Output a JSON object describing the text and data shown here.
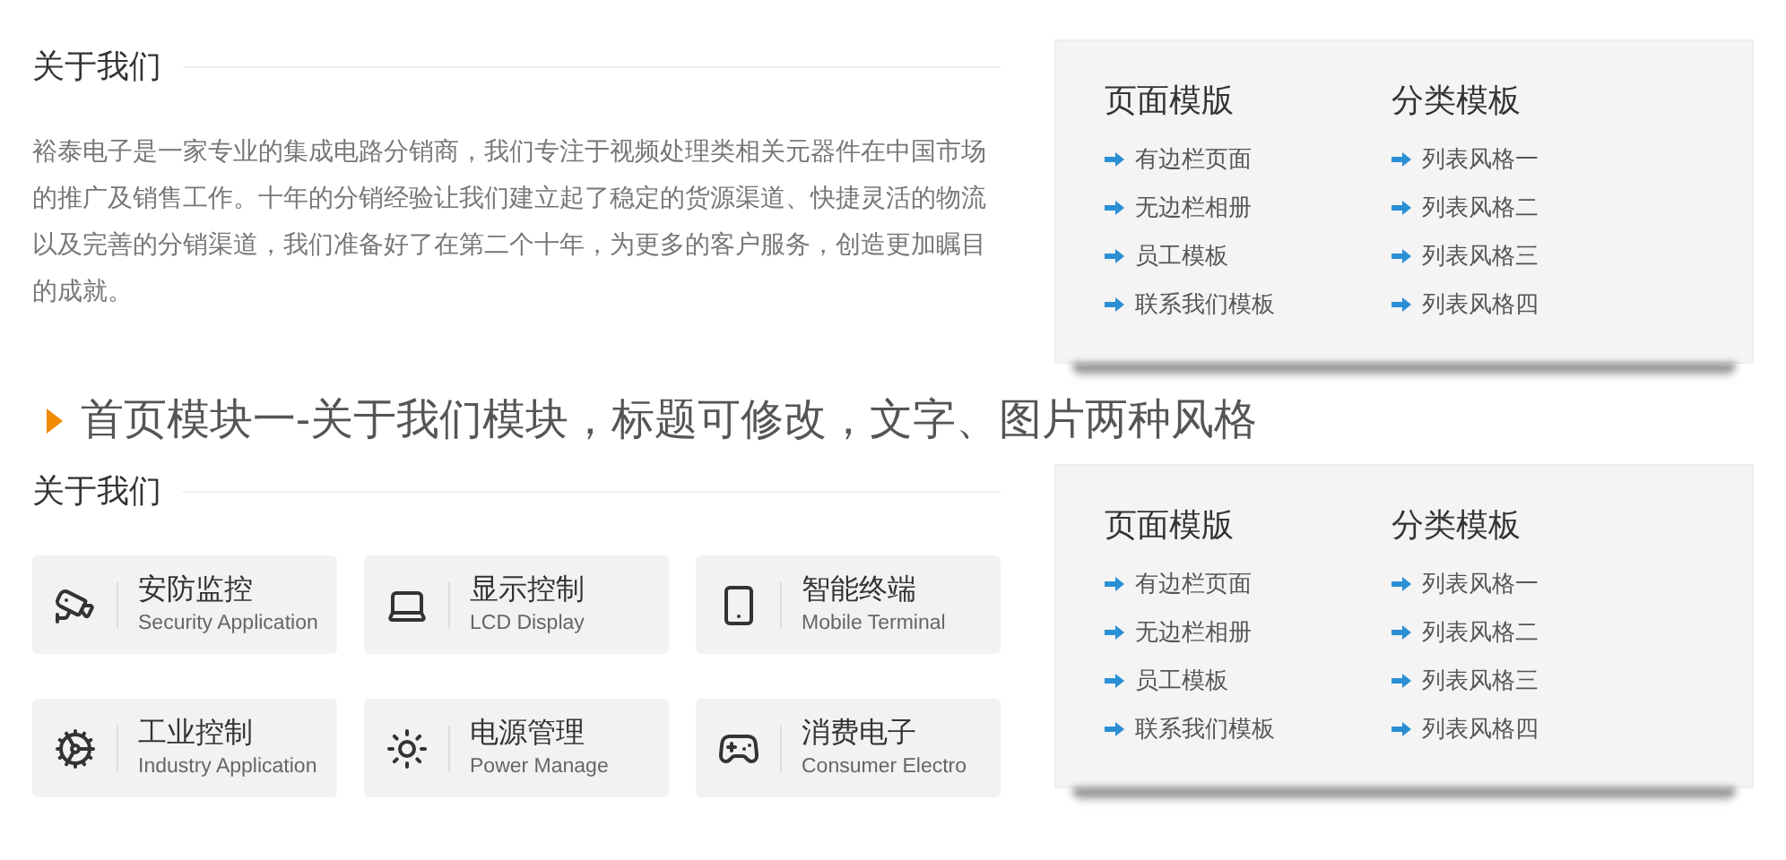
{
  "about_top": {
    "title": "关于我们",
    "paragraph": "裕泰电子是一家专业的集成电路分销商，我们专注于视频处理类相关元器件在中国市场的推广及销售工作。十年的分销经验让我们建立起了稳定的货源渠道、快捷灵活的物流以及完善的分销渠道，我们准备好了在第二个十年，为更多的客户服务，创造更加瞩目的成就。"
  },
  "panel_top": {
    "columns": [
      {
        "heading": "页面模版",
        "links": [
          "有边栏页面",
          "无边栏相册",
          "员工模板",
          "联系我们模板"
        ]
      },
      {
        "heading": "分类模板",
        "links": [
          "列表风格一",
          "列表风格二",
          "列表风格三",
          "列表风格四"
        ]
      }
    ]
  },
  "banner": {
    "title": "首页模块一-关于我们模块，标题可修改，文字、图片两种风格"
  },
  "about_bottom": {
    "title": "关于我们",
    "cards": [
      {
        "kind": "camera",
        "title": "安防监控",
        "subtitle": "Security Application"
      },
      {
        "kind": "laptop",
        "title": "显示控制",
        "subtitle": "LCD Display"
      },
      {
        "kind": "phone",
        "title": "智能终端",
        "subtitle": "Mobile Terminal"
      },
      {
        "kind": "gears",
        "title": "工业控制",
        "subtitle": "Industry Application"
      },
      {
        "kind": "sun",
        "title": "电源管理",
        "subtitle": "Power Manage"
      },
      {
        "kind": "gamepad",
        "title": "消费电子",
        "subtitle": "Consumer Electro"
      }
    ]
  },
  "panel_bottom": {
    "columns": [
      {
        "heading": "页面模版",
        "links": [
          "有边栏页面",
          "无边栏相册",
          "员工模板",
          "联系我们模板"
        ]
      },
      {
        "heading": "分类模板",
        "links": [
          "列表风格一",
          "列表风格二",
          "列表风格三",
          "列表风格四"
        ]
      }
    ]
  }
}
